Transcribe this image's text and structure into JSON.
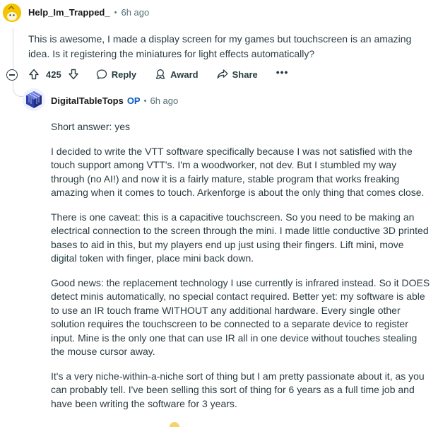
{
  "comment": {
    "username": "Help_Im_Trapped_",
    "separator": "•",
    "time": "6h ago",
    "body": "This is awesome, I made a display screen for my games but touchscreen is an amazing idea. Is it registering the miniatures for light effects automatically?",
    "actions": {
      "score": "425",
      "reply_label": "Reply",
      "award_label": "Award",
      "share_label": "Share",
      "more_label": "•••"
    }
  },
  "reply": {
    "username": "DigitalTableTops",
    "op_badge": "OP",
    "separator": "•",
    "time": "6h ago",
    "paragraphs": [
      "Short answer: yes",
      "I decided to write the VTT software specifically because I was not satisfied with the touch support among VTT's. I'm a woodworker, not dev. But I stumbled my way through (no AI!) and now it is a fairly mature, stable program that works freaking amazing when it comes to touch. Arkenforge is about the only thing that comes close.",
      "There is one caveat: this is a capacitive touchscreen. So you need to be making an electrical connection to the screen through the mini. I made little conductive 3D printed bases to aid in this, but my players end up just using their fingers. Lift mini, move digital token with finger, place mini back down.",
      "Good news: the replacement technology I use currently is infrared instead. So it DOES detect minis automatically, no special contact required. Better yet: my software is able to use an IR touch frame WITHOUT any additional hardware. Every single other solution requires the touchscreen to be connected to a separate device to register input. Mine is the only one that can use IR all in one device without touches stealing the mouse cursor away.",
      "It's a very niche-within-a-niche sort of thing but I am pretty passionate about it, as you can probably tell. I've been selling this sort of thing for 6 years as a full time job and have been writing the software for 3 years."
    ]
  },
  "colors": {
    "text": "#2a3c42",
    "muted": "#576f76",
    "op_blue": "#0a5cc2",
    "thread_line": "#d6dadc"
  },
  "icons": [
    "upvote-icon",
    "downvote-icon",
    "reply-icon",
    "award-icon",
    "share-icon",
    "collapse-icon"
  ]
}
